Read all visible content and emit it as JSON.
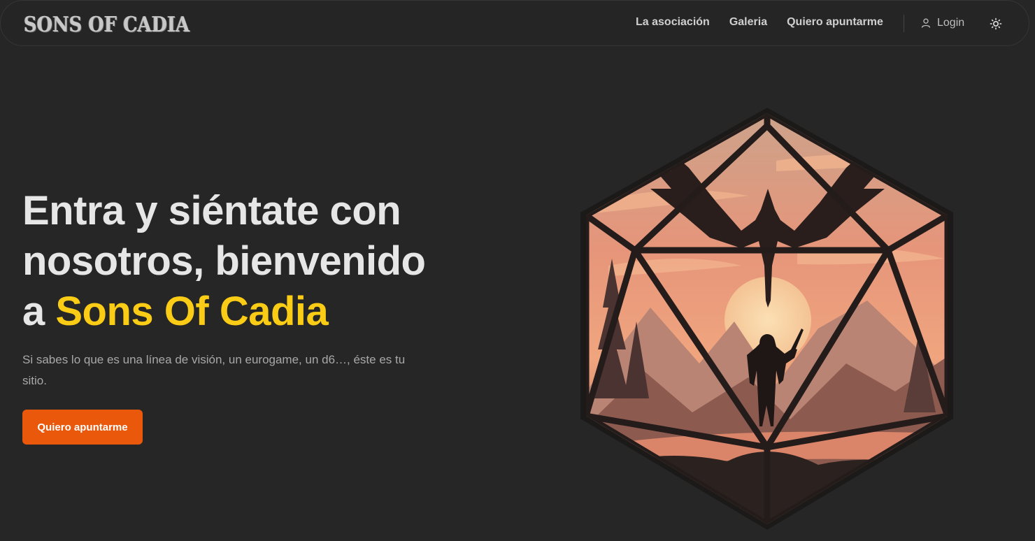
{
  "nav": {
    "logo": "SONS OF CADIA",
    "links": [
      "La asociación",
      "Galeria",
      "Quiero apuntarme"
    ],
    "login_label": "Login",
    "login_icon": "user-icon",
    "theme_icon": "sun-icon"
  },
  "hero": {
    "title_line1": "Entra y siéntate con",
    "title_line2": "nosotros, bienvenido",
    "title_prefix": "a ",
    "title_accent": "Sons Of Cadia",
    "subtitle": "Si sabes lo que es una línea de visión, un eurogame, un d6…, éste es tu sitio.",
    "cta_label": "Quiero apuntarme"
  },
  "colors": {
    "background": "#262626",
    "accent_yellow": "#facc15",
    "cta_orange": "#ea580c"
  }
}
